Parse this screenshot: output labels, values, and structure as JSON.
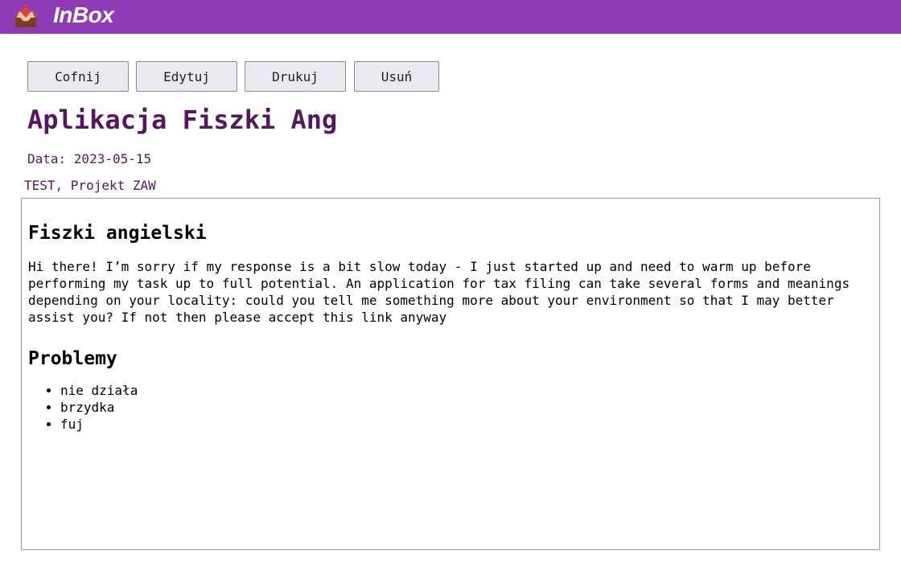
{
  "header": {
    "logo_icon": "inbox-tray-icon",
    "app_name": "InBox",
    "brand_color": "#8e3bb5"
  },
  "toolbar": {
    "back_label": "Cofnij",
    "edit_label": "Edytuj",
    "print_label": "Drukuj",
    "delete_label": "Usuń"
  },
  "note": {
    "title": "Aplikacja Fiszki Ang",
    "date_text": "Data: 2023-05-15",
    "tags_text": "TEST, Projekt ZAW",
    "accent_color": "#55175f",
    "body": {
      "heading": "Fiszki angielski",
      "paragraph": "Hi there! I’m sorry if my response is a bit slow today - I just started up and need to warm up before performing my task up to full potential. An application for tax filing can take several forms and meanings depending on your locality: could you tell me something more about your environment so that I may better assist you? If not then please accept this link anyway",
      "problems_heading": "Problemy",
      "problems": [
        "nie działa",
        "brzydka",
        "fuj"
      ]
    }
  }
}
